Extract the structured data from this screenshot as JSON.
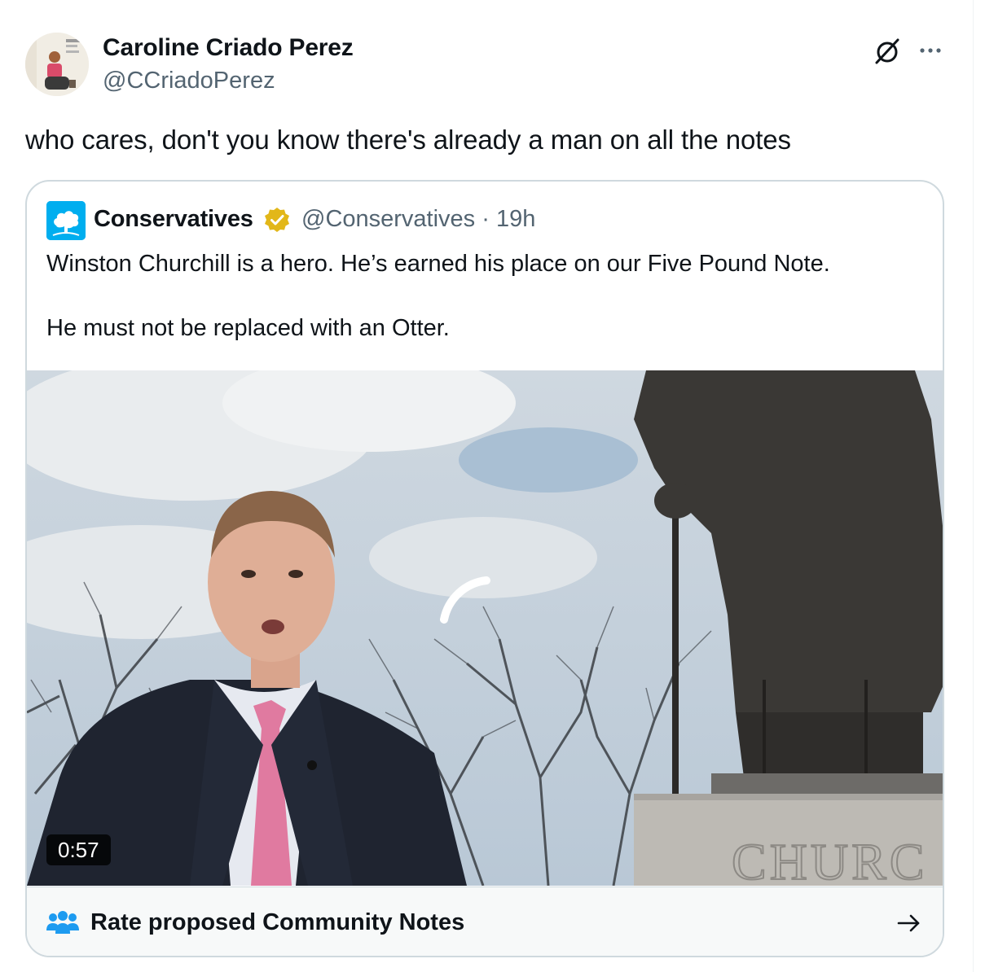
{
  "tweet": {
    "author_name": "Caroline Criado Perez",
    "author_handle": "@CCriadoPerez",
    "text": "who cares, don't you know there's already a man on all the notes"
  },
  "actions": {
    "grok_icon": "grok-icon",
    "more_icon": "more-horizontal-icon"
  },
  "quote": {
    "author_name": "Conservatives",
    "author_handle": "@Conservatives",
    "separator": "·",
    "time": "19h",
    "verified_icon": "verified-gold-badge-icon",
    "text_line1": "Winston Churchill is a hero. He’s earned his place on our Five Pound Note.",
    "text_line2": "He must not be replaced with an Otter.",
    "video": {
      "duration": "0:57",
      "plinth_inscription": "CHURC"
    }
  },
  "community_notes": {
    "label": "Rate proposed Community Notes",
    "icon": "people-icon",
    "arrow_icon": "arrow-right-icon"
  },
  "colors": {
    "text": "#0f1419",
    "secondary": "#536471",
    "border": "#cfd9de",
    "accent_blue": "#1d9bf0",
    "verified_gold": "#e2b719"
  }
}
